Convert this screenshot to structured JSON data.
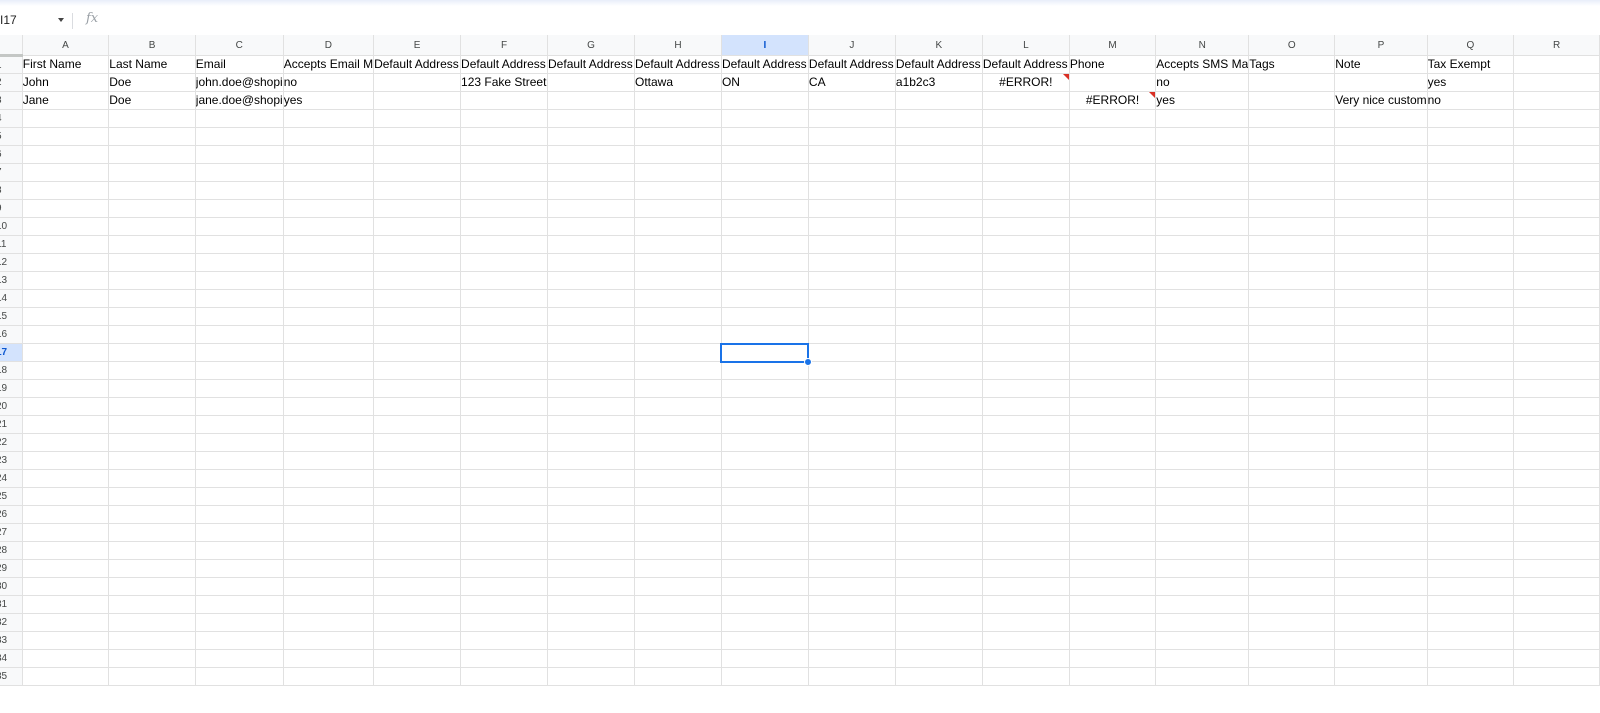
{
  "name_box": "I17",
  "fx_label": "fx",
  "columns": [
    "A",
    "B",
    "C",
    "D",
    "E",
    "F",
    "G",
    "H",
    "I",
    "J",
    "K",
    "L",
    "M",
    "N",
    "O",
    "P",
    "Q",
    "R"
  ],
  "selected_column": "I",
  "selected_row": 17,
  "row_count": 35,
  "rows": [
    [
      "First Name",
      "Last Name",
      "Email",
      "Accepts Email M",
      "Default Address",
      "Default Address",
      "Default Address",
      "Default Address",
      "Default Address",
      "Default Address",
      "Default Address",
      "Default Address",
      "Phone",
      "Accepts SMS Ma",
      "Tags",
      "Note",
      "Tax Exempt",
      ""
    ],
    [
      "John",
      "Doe",
      "john.doe@shopi",
      "no",
      "",
      "123 Fake Street",
      "",
      "Ottawa",
      "ON",
      "CA",
      "a1b2c3",
      "#ERROR!",
      "",
      "no",
      "",
      "",
      "yes",
      ""
    ],
    [
      "Jane",
      "Doe",
      "jane.doe@shopi",
      "yes",
      "",
      "",
      "",
      "",
      "",
      "",
      "",
      "",
      "#ERROR!",
      "yes",
      "",
      "Very nice custom",
      "no",
      ""
    ]
  ],
  "error_cells": [
    {
      "row": 2,
      "col": 11
    },
    {
      "row": 3,
      "col": 12
    }
  ],
  "active_cell": {
    "row": 17,
    "col": 8
  }
}
